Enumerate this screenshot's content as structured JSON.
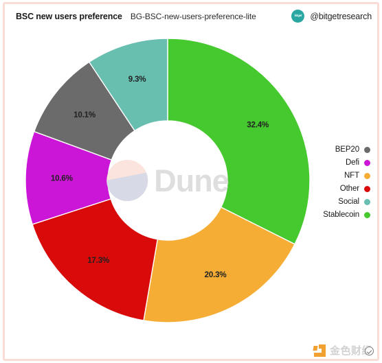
{
  "header": {
    "title": "BSC new users preference",
    "subtitle": "BG-BSC-new-users-preference-lite",
    "avatar_icon": "bitget-avatar-icon",
    "avatar_mark": "bitget",
    "handle": "@bitgetresearch"
  },
  "watermark": {
    "dune_text": "Dune",
    "dune_logo_icon": "dune-logo-icon",
    "brand_text": "金色财经",
    "brand_mark_icon": "jinse-logo-icon"
  },
  "legend": {
    "items": [
      {
        "label": "BEP20",
        "color": "#6b6b6b"
      },
      {
        "label": "Defi",
        "color": "#cb16d8"
      },
      {
        "label": "NFT",
        "color": "#f5ad35"
      },
      {
        "label": "Other",
        "color": "#d90a0a"
      },
      {
        "label": "Social",
        "color": "#68bfb0"
      },
      {
        "label": "Stablecoin",
        "color": "#45c92e"
      }
    ]
  },
  "chart_data": {
    "type": "pie",
    "title": "BSC new users preference",
    "subtitle": "BG-BSC-new-users-preference-lite",
    "donut": true,
    "inner_radius_ratio": 0.42,
    "start_angle_deg": -90,
    "direction": "clockwise",
    "legend_position": "right",
    "grid": false,
    "categories": [
      "Stablecoin",
      "NFT",
      "Other",
      "Defi",
      "BEP20",
      "Social"
    ],
    "values": [
      32.4,
      20.3,
      17.3,
      10.6,
      10.1,
      9.3
    ],
    "labels": [
      "32.4%",
      "20.3%",
      "17.3%",
      "10.6%",
      "10.1%",
      "9.3%"
    ],
    "colors": [
      "#45c92e",
      "#f5ad35",
      "#d90a0a",
      "#cb16d8",
      "#6b6b6b",
      "#68bfb0"
    ],
    "unit": "%",
    "xlabel": "",
    "ylabel": ""
  }
}
